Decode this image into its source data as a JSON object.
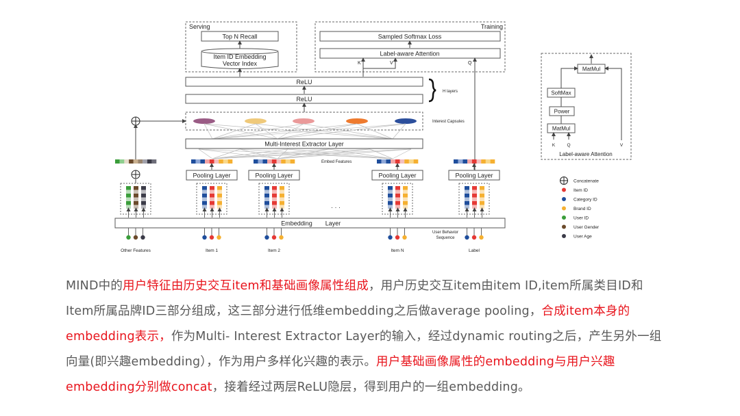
{
  "diagram": {
    "serving": {
      "label": "Serving",
      "top_n_recall": "Top N Recall",
      "vector_index_line1": "Item ID Embedding",
      "vector_index_line2": "Vector Index"
    },
    "training": {
      "label": "Training",
      "sampled_softmax_loss": "Sampled Softmax Loss",
      "label_aware_attention": "Label-aware Attention",
      "k": "K",
      "v": "V",
      "q": "Q"
    },
    "relu_top": "ReLU",
    "relu_bottom": "ReLU",
    "h_layers": "H layers",
    "interest_capsules": "Interest Capsules",
    "capsule_colors": [
      "#9a5c85",
      "#efc97a",
      "#ea9a9a",
      "#ee7a2e",
      "#2c4f9c"
    ],
    "multi_interest_extractor": "Multi-Interest Extractor Layer",
    "embed_features": "Embed Features",
    "pooling_layer": "Pooling Layer",
    "embedding_layer_word1": "Embedding",
    "embedding_layer_word2": "Layer",
    "ellipsis": "· · ·",
    "user_behavior_line1": "User Behavior",
    "user_behavior_line2": "Sequence",
    "groups": [
      "Other Features",
      "Item 1",
      "Item 2",
      "Item N",
      "Label"
    ],
    "attention_detail": {
      "matmul_top": "MatMul",
      "softmax": "SoftMax",
      "power": "Power",
      "matmul_bottom": "MatMul",
      "k": "K",
      "q": "Q",
      "v": "V",
      "title": "Label-aware Attention"
    },
    "legend": [
      {
        "label": "Concatenate",
        "symbol": "concat"
      },
      {
        "label": "Item ID",
        "color": "#e53935"
      },
      {
        "label": "Category ID",
        "color": "#1f4e9c"
      },
      {
        "label": "Brand ID",
        "color": "#f5b031"
      },
      {
        "label": "User ID",
        "color": "#3a9d3a"
      },
      {
        "label": "User Gender",
        "color": "#6b4a2b"
      },
      {
        "label": "User Age",
        "color": "#3b3b48"
      }
    ]
  },
  "caption": {
    "segments": [
      {
        "text": "MIND中的",
        "red": false
      },
      {
        "text": "用户特征由历史交互item和基础画像属性组成",
        "red": true
      },
      {
        "text": "，用户历史交互item由item ID,item所属类目ID和Item所属品牌ID三部分组成，这三部分进行低维embedding之后做average pooling，",
        "red": false
      },
      {
        "text": "合成item本身的embedding表示，",
        "red": true
      },
      {
        "text": "作为Multi- Interest Extractor Layer的输入，经过dynamic routing之后，产生另外一组向量(即兴趣embedding），作为用户多样化兴趣的表示。",
        "red": false
      },
      {
        "text": "用户基础画像属性的embedding与用户兴趣embedding分别做concat",
        "red": true
      },
      {
        "text": "，接着经过两层ReLU隐层，得到用户的一组embedding。",
        "red": false
      }
    ]
  }
}
